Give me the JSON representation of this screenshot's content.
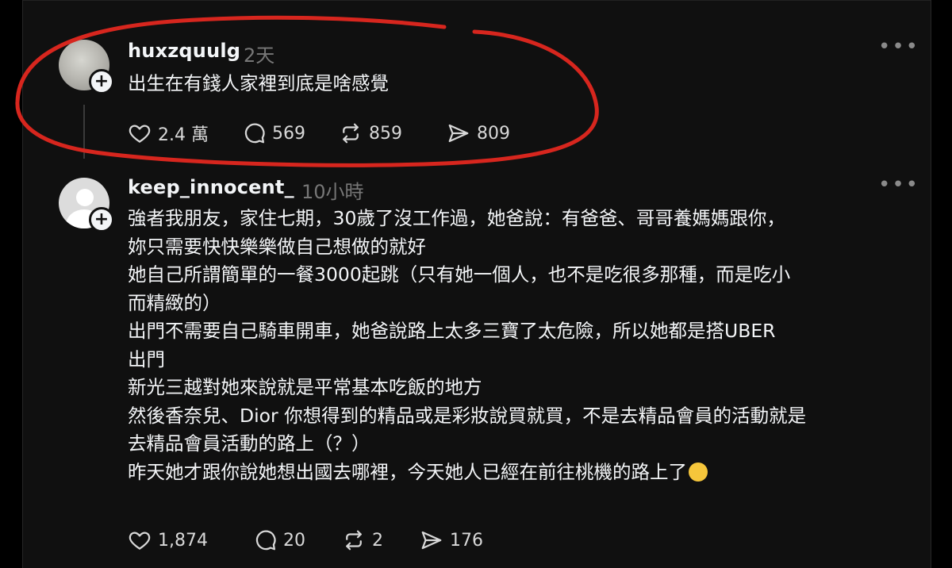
{
  "posts": [
    {
      "username": "huxzquulg",
      "time": "2天",
      "lines": [
        "出生在有錢人家裡到底是啥感覺"
      ],
      "stats": {
        "likes": "2.4 萬",
        "replies": "569",
        "reposts": "859",
        "shares": "809"
      }
    },
    {
      "username": "keep_innocent_",
      "time": "10小時",
      "lines": [
        "強者我朋友，家住七期，30歲了沒工作過，她爸說：有爸爸、哥哥養媽媽跟你，",
        "妳只需要快快樂樂做自己想做的就好",
        "她自己所謂簡單的一餐3000起跳（只有她一個人，也不是吃很多那種，而是吃小",
        "而精緻的）",
        "出門不需要自己騎車開車，她爸說路上太多三寶了太危險，所以她都是搭UBER",
        "出門",
        "新光三越對她來說就是平常基本吃飯的地方",
        "然後香奈兒、Dior 你想得到的精品或是彩妝說買就買，不是去精品會員的活動就是",
        "去精品會員活動的路上（？）",
        "昨天她才跟你說她想出國去哪裡，今天她人已經在前往桃機的路上了"
      ],
      "emoji": "melting-face-emoji",
      "stats": {
        "likes": "1,874",
        "replies": "20",
        "reposts": "2",
        "shares": "176"
      }
    }
  ],
  "colors": {
    "background": "#101010",
    "text": "#f3f5f7",
    "muted": "#777777",
    "annotation": "#d7261e"
  },
  "icons": [
    "heart-icon",
    "comment-icon",
    "repost-icon",
    "share-icon",
    "more-icon",
    "follow-plus-icon"
  ]
}
